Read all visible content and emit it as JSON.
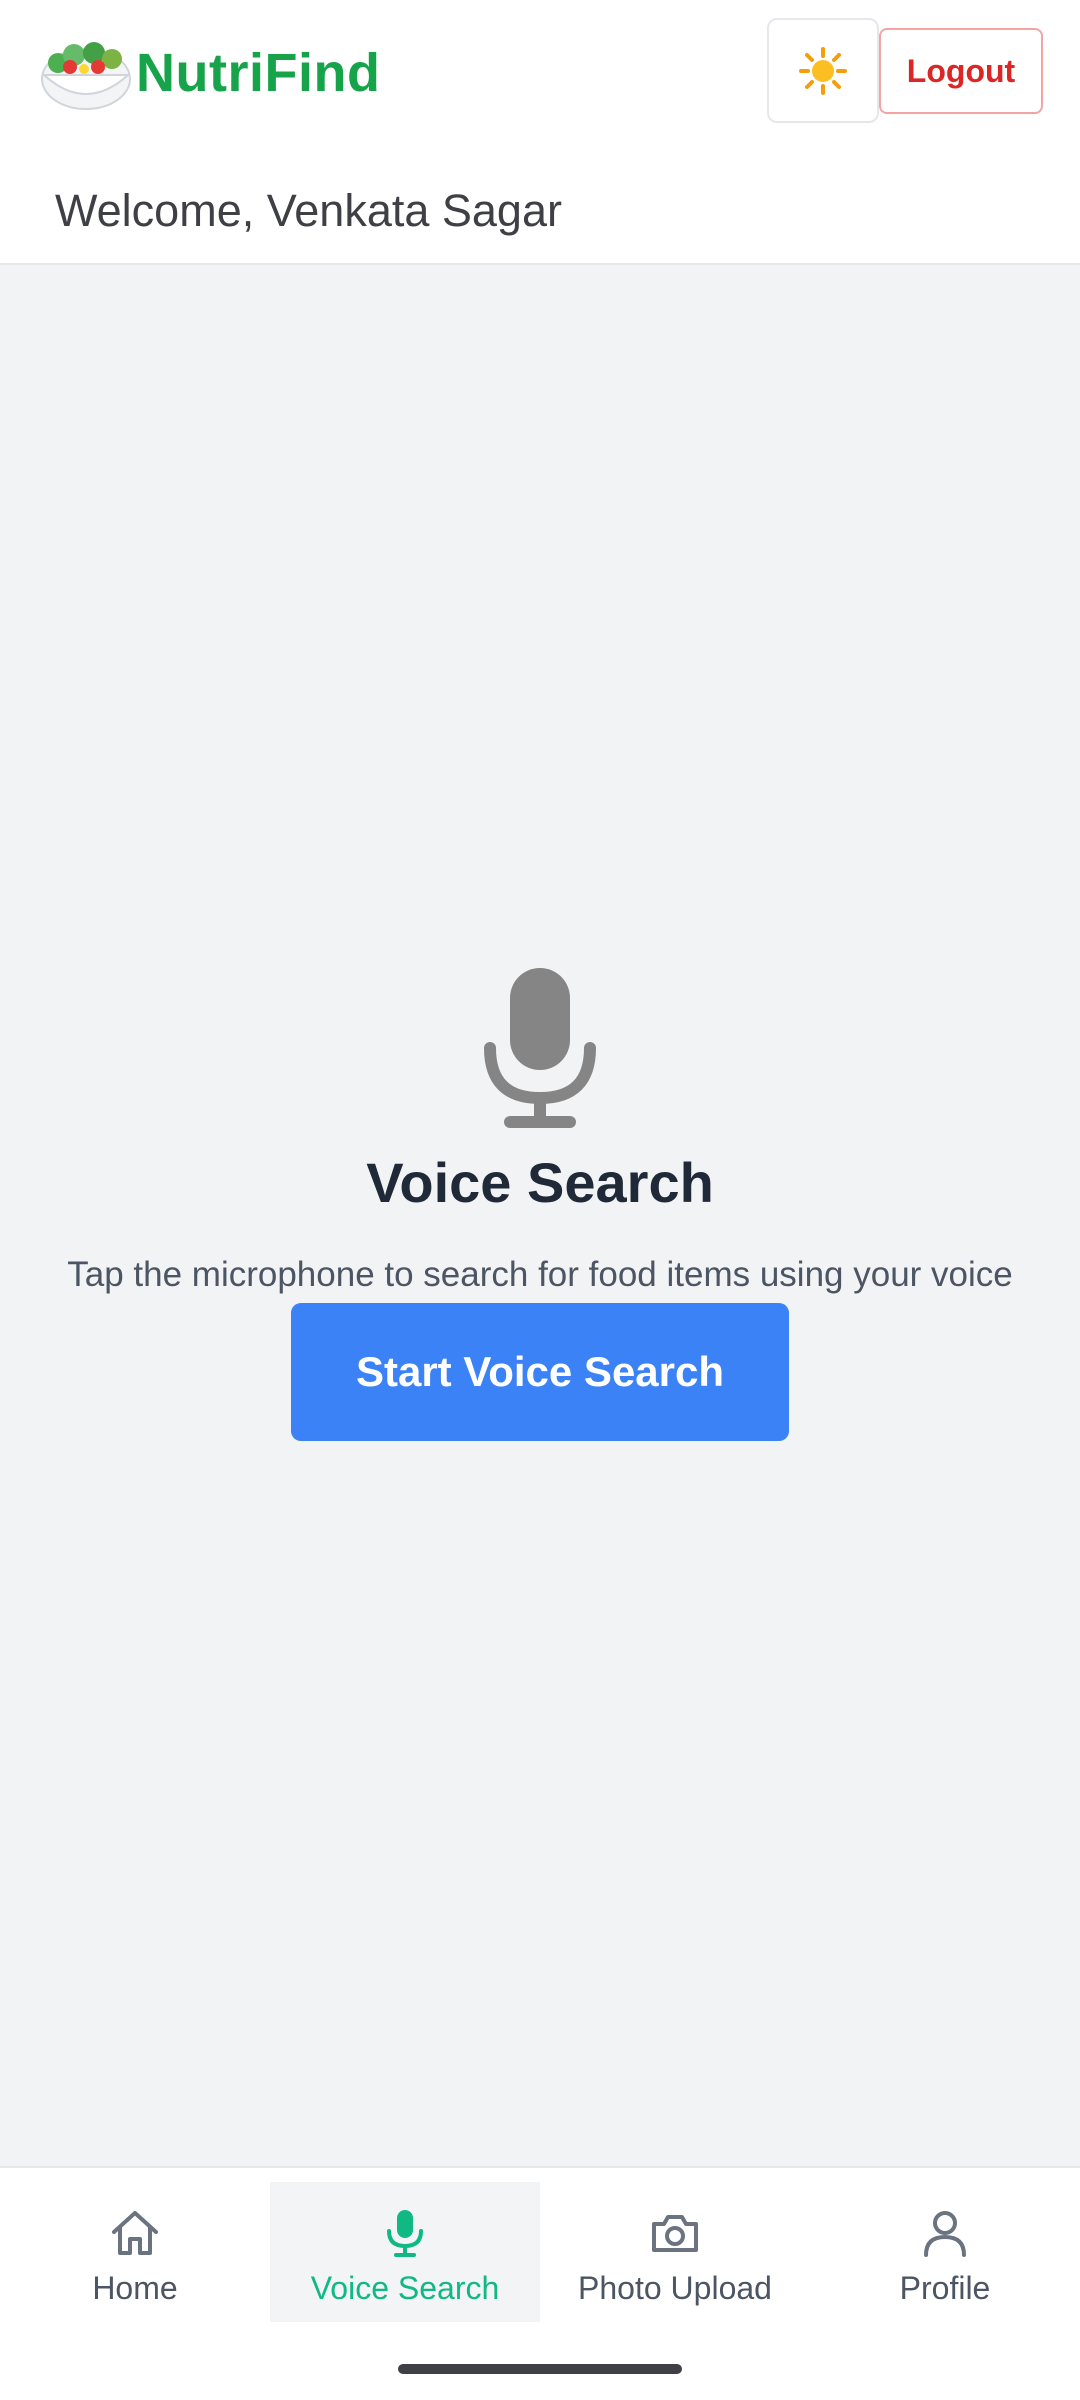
{
  "header": {
    "app_name": "NutriFind",
    "logout_label": "Logout",
    "welcome_text": "Welcome, Venkata Sagar",
    "theme_icon": "sun-icon",
    "logo_icon": "salad-bowl-icon"
  },
  "main": {
    "icon": "microphone-icon",
    "title": "Voice Search",
    "description": "Tap the microphone to search for food items using your voice",
    "button_label": "Start Voice Search"
  },
  "nav": {
    "items": [
      {
        "label": "Home",
        "icon": "home-icon",
        "active": false
      },
      {
        "label": "Voice Search",
        "icon": "microphone-icon",
        "active": true
      },
      {
        "label": "Photo Upload",
        "icon": "camera-icon",
        "active": false
      },
      {
        "label": "Profile",
        "icon": "user-icon",
        "active": false
      }
    ]
  },
  "colors": {
    "brand": "#16a34a",
    "primary_button": "#3b82f6",
    "active_nav": "#10b981",
    "logout": "#dc2626"
  }
}
